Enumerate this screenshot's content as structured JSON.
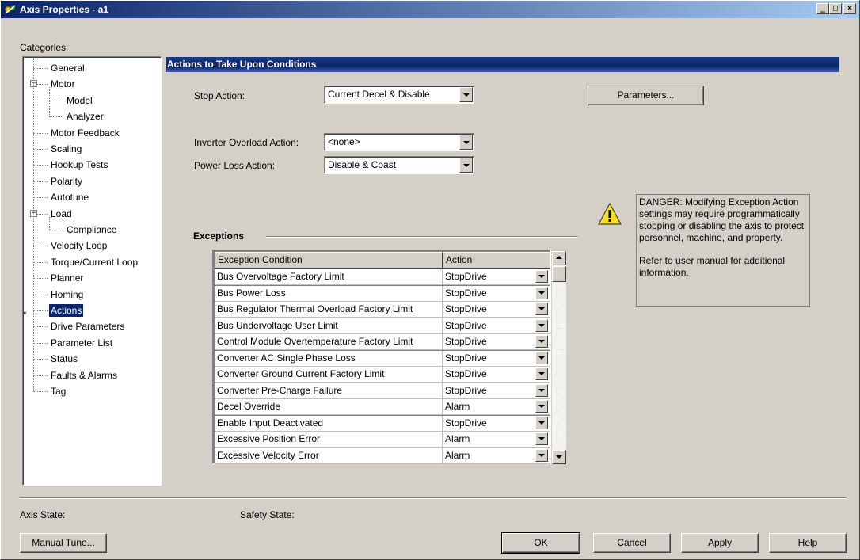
{
  "window": {
    "title": "Axis Properties - a1",
    "controls": [
      "_",
      "□",
      "×"
    ]
  },
  "categories_label": "Categories:",
  "tree": [
    {
      "label": "General",
      "level": 1
    },
    {
      "label": "Motor",
      "level": 1,
      "expander": "−"
    },
    {
      "label": "Model",
      "level": 2
    },
    {
      "label": "Analyzer",
      "level": 2
    },
    {
      "label": "Motor Feedback",
      "level": 1
    },
    {
      "label": "Scaling",
      "level": 1
    },
    {
      "label": "Hookup Tests",
      "level": 1
    },
    {
      "label": "Polarity",
      "level": 1
    },
    {
      "label": "Autotune",
      "level": 1
    },
    {
      "label": "Load",
      "level": 1,
      "expander": "−"
    },
    {
      "label": "Compliance",
      "level": 2
    },
    {
      "label": "Velocity Loop",
      "level": 1
    },
    {
      "label": "Torque/Current Loop",
      "level": 1
    },
    {
      "label": "Planner",
      "level": 1
    },
    {
      "label": "Homing",
      "level": 1
    },
    {
      "label": "Actions",
      "level": 1,
      "selected": true
    },
    {
      "label": "Drive Parameters",
      "level": 1
    },
    {
      "label": "Parameter List",
      "level": 1
    },
    {
      "label": "Status",
      "level": 1
    },
    {
      "label": "Faults & Alarms",
      "level": 1
    },
    {
      "label": "Tag",
      "level": 1
    }
  ],
  "modified_marker": "*",
  "section_title": "Actions to Take Upon Conditions",
  "stop_action": {
    "label": "Stop Action:",
    "value": "Current Decel & Disable"
  },
  "parameters_button": "Parameters...",
  "inverter_overload": {
    "label": "Inverter Overload Action:",
    "value": "<none>"
  },
  "power_loss": {
    "label": "Power Loss Action:",
    "value": "Disable & Coast"
  },
  "danger": {
    "icon": "warning-icon",
    "line1": "DANGER: Modifying Exception Action settings may require programmatically stopping or disabling the axis to protect personnel, machine, and property.",
    "line2": "Refer to user manual for additional information."
  },
  "exceptions": {
    "title": "Exceptions",
    "headers": [
      "Exception Condition",
      "Action"
    ],
    "rows": [
      [
        "Bus Overvoltage Factory Limit",
        "StopDrive"
      ],
      [
        "Bus Power Loss",
        "StopDrive"
      ],
      [
        "Bus Regulator Thermal Overload Factory Limit",
        "StopDrive"
      ],
      [
        "Bus Undervoltage User Limit",
        "StopDrive"
      ],
      [
        "Control Module Overtemperature Factory Limit",
        "StopDrive"
      ],
      [
        "Converter AC Single Phase Loss",
        "StopDrive"
      ],
      [
        "Converter Ground Current Factory Limit",
        "StopDrive"
      ],
      [
        "Converter Pre-Charge Failure",
        "StopDrive"
      ],
      [
        "Decel Override",
        "Alarm"
      ],
      [
        "Enable Input Deactivated",
        "StopDrive"
      ],
      [
        "Excessive Position Error",
        "Alarm"
      ],
      [
        "Excessive Velocity Error",
        "Alarm"
      ]
    ]
  },
  "status": {
    "axis_state_label": "Axis State:",
    "safety_state_label": "Safety State:"
  },
  "buttons": {
    "manual_tune": "Manual Tune...",
    "ok": "OK",
    "cancel": "Cancel",
    "apply": "Apply",
    "help": "Help"
  },
  "colors": {
    "title_start": "#0a246a",
    "title_end": "#a6caf0",
    "selection": "#0a246a",
    "face": "#d4d0c8"
  }
}
